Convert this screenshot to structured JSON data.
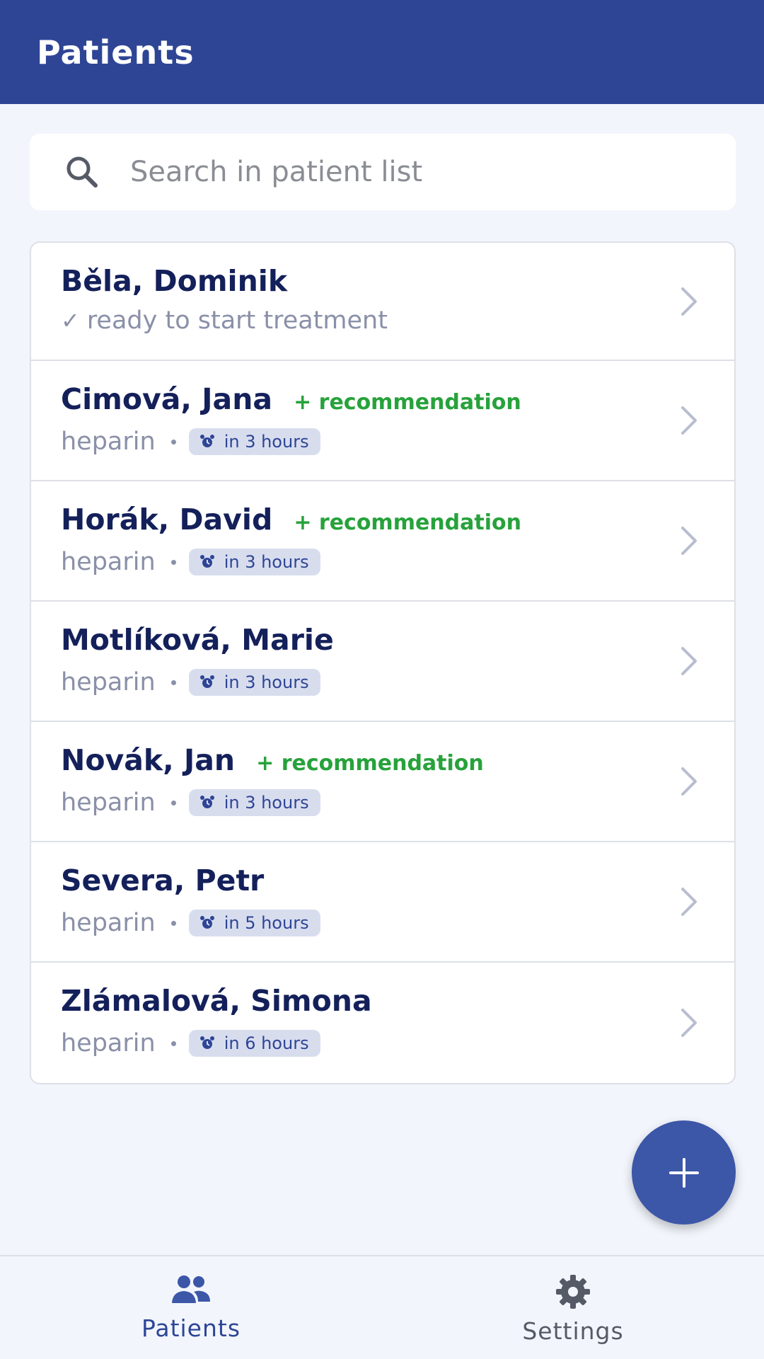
{
  "app_bar": {
    "title": "Patients"
  },
  "search": {
    "placeholder": "Search in patient list",
    "value": "",
    "icon": "search-icon"
  },
  "patients": [
    {
      "name": "Běla, Dominik",
      "status": "ready to start treatment",
      "status_icon": "check-icon"
    },
    {
      "name": "Cimová, Jana",
      "recommendation": "+ recommendation",
      "drug": "heparin",
      "due": "in 3 hours"
    },
    {
      "name": "Horák, David",
      "recommendation": "+ recommendation",
      "drug": "heparin",
      "due": "in 3 hours"
    },
    {
      "name": "Motlíková, Marie",
      "drug": "heparin",
      "due": "in 3 hours"
    },
    {
      "name": "Novák, Jan",
      "recommendation": "+ recommendation",
      "drug": "heparin",
      "due": "in 3 hours"
    },
    {
      "name": "Severa, Petr",
      "drug": "heparin",
      "due": "in 5 hours"
    },
    {
      "name": "Zlámalová, Simona",
      "drug": "heparin",
      "due": "in 6 hours"
    }
  ],
  "fab": {
    "icon": "plus-icon"
  },
  "bottom_nav": [
    {
      "label": "Patients",
      "icon": "people-icon",
      "active": true
    },
    {
      "label": "Settings",
      "icon": "gear-icon",
      "active": false
    }
  ],
  "colors": {
    "app_bar": "#2e4596",
    "name": "#14205a",
    "recommendation": "#27a23b",
    "badge_bg": "#d8ddee",
    "fab": "#3c56a8"
  }
}
